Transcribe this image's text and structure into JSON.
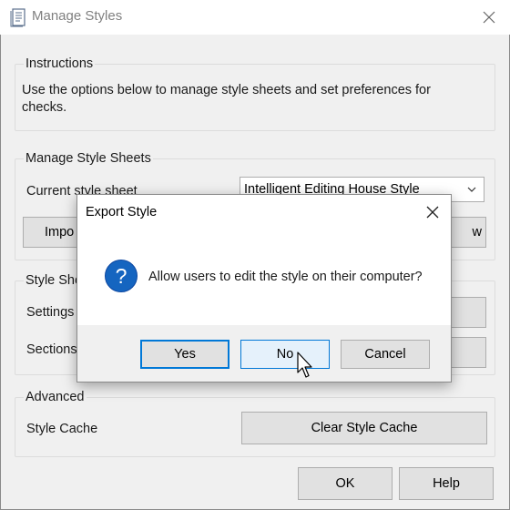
{
  "window": {
    "title": "Manage Styles"
  },
  "instructions": {
    "heading": "Instructions",
    "line1": "Use the options below to manage style sheets and set preferences for",
    "line2": "checks."
  },
  "manage_sheets": {
    "heading": "Manage Style Sheets",
    "current_label": "Current style sheet",
    "current_value": "Intelligent Editing House Style",
    "import_label_partial": "Impo",
    "right_button_partial": "w"
  },
  "style_sheet": {
    "heading_partial": "Style She",
    "settings_partial": "Settings",
    "sections_partial": "Sections"
  },
  "advanced": {
    "heading": "Advanced",
    "cache_label": "Style Cache",
    "clear_button": "Clear Style Cache"
  },
  "footer": {
    "ok": "OK",
    "help": "Help"
  },
  "dialog": {
    "title": "Export Style",
    "message": "Allow users to edit the style on their computer?",
    "yes": "Yes",
    "no": "No",
    "cancel": "Cancel",
    "icon": "question-icon"
  },
  "colors": {
    "accent": "#0078d7",
    "question_icon": "#1565c0"
  }
}
